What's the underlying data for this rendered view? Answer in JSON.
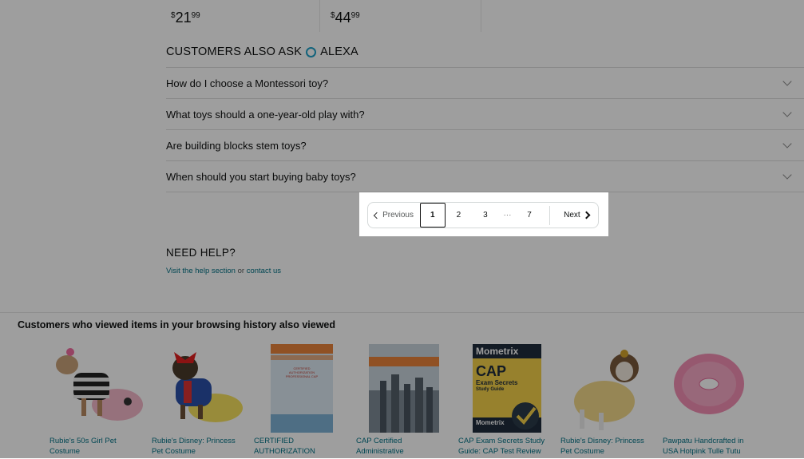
{
  "prices": [
    {
      "symbol": "$",
      "whole": "21",
      "cents": "99"
    },
    {
      "symbol": "$",
      "whole": "44",
      "cents": "99"
    }
  ],
  "alexa": {
    "title_prefix": "CUSTOMERS ALSO ASK",
    "title_suffix": "ALEXA",
    "questions": [
      "How do I choose a Montessori toy?",
      "What toys should a one-year-old play with?",
      "Are building blocks stem toys?",
      "When should you start buying baby toys?"
    ]
  },
  "pagination": {
    "previous": "Previous",
    "pages": [
      "1",
      "2",
      "3"
    ],
    "ellipsis": "···",
    "last": "7",
    "next": "Next",
    "current": "1"
  },
  "help": {
    "title": "NEED HELP?",
    "link1": "Visit the help section",
    "or": " or ",
    "link2": "contact us"
  },
  "history": {
    "title": "Customers who viewed items in your browsing history also viewed",
    "items": [
      {
        "line1": "Rubie's 50s Girl Pet",
        "line2": "Costume"
      },
      {
        "line1": "Rubie's Disney: Princess",
        "line2": "Pet Costume"
      },
      {
        "line1": "CERTIFIED",
        "line2": "AUTHORIZATION"
      },
      {
        "line1": "CAP Certified",
        "line2": "Administrative"
      },
      {
        "line1": "CAP Exam Secrets Study",
        "line2": "Guide: CAP Test Review"
      },
      {
        "line1": "Rubie's Disney: Princess",
        "line2": "Pet Costume"
      },
      {
        "line1": "Pawpatu Handcrafted in",
        "line2": "USA Hotpink Tulle Tutu"
      }
    ],
    "book_cover_text": {
      "mometrix": "Mometrix",
      "cap": "CAP",
      "exam": "Exam Secrets",
      "guide": "Study Guide",
      "certified": "CERTIFIED AUTHORIZATION PROFESSIONAL CAP"
    }
  },
  "colors": {
    "link": "#007185",
    "alexa_ring": "#1fa1c9",
    "overlay": "rgba(0,0,0,0.38)"
  }
}
